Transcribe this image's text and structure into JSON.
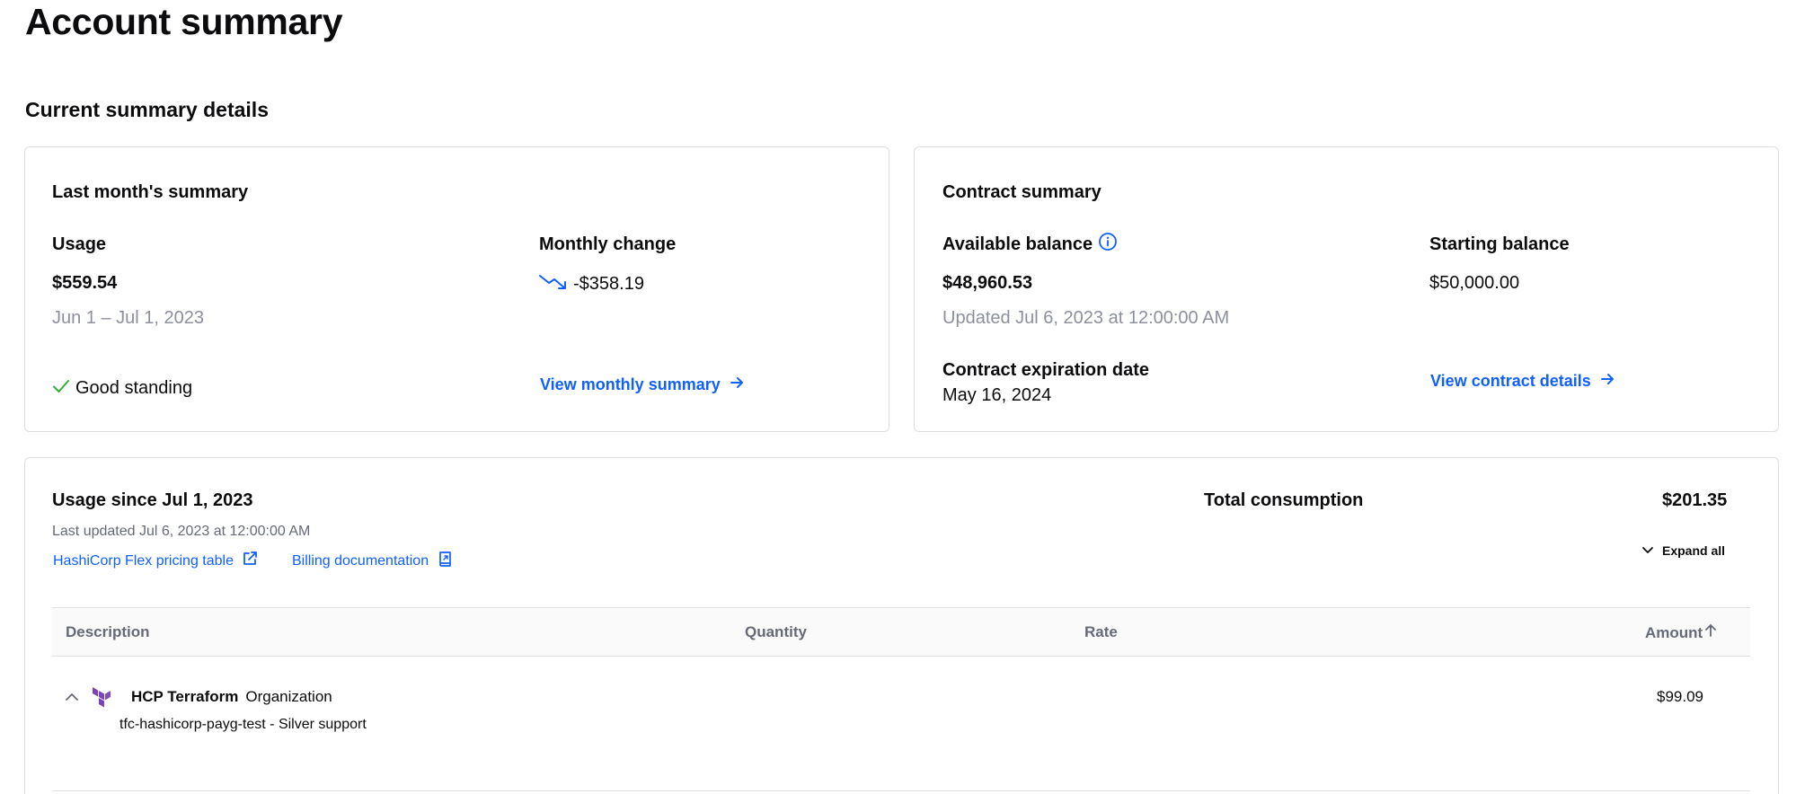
{
  "page": {
    "title": "Account summary",
    "section_title": "Current summary details"
  },
  "last_month": {
    "heading": "Last month's summary",
    "usage_label": "Usage",
    "usage_value": "$559.54",
    "usage_period": "Jun 1 – Jul 1, 2023",
    "standing": "Good standing",
    "monthly_change_label": "Monthly change",
    "monthly_change_value": "-$358.19",
    "link": "View monthly summary"
  },
  "contract": {
    "heading": "Contract summary",
    "available_label": "Available balance",
    "available_value": "$48,960.53",
    "updated": "Updated Jul 6, 2023 at 12:00:00 AM",
    "starting_label": "Starting balance",
    "starting_value": "$50,000.00",
    "expiration_label": "Contract expiration date",
    "expiration_value": "May 16, 2024",
    "link": "View contract details"
  },
  "usage": {
    "heading": "Usage since Jul 1, 2023",
    "last_updated": "Last updated Jul 6, 2023 at 12:00:00 AM",
    "pricing_link": "HashiCorp Flex pricing table",
    "billing_link": "Billing documentation",
    "total_label": "Total consumption",
    "total_value": "$201.35",
    "expand_label": "Expand all",
    "table": {
      "columns": [
        "Description",
        "Quantity",
        "Rate",
        "Amount"
      ],
      "rows": [
        {
          "product": "HCP Terraform",
          "type": "Organization",
          "detail": "tfc-hashicorp-payg-test - Silver support",
          "amount": "$99.09"
        }
      ]
    }
  },
  "colors": {
    "link": "#1060ff",
    "success": "#14c6cb",
    "success_check": "#2eb039",
    "terraform": "#7b42bc",
    "border": "#dedee3",
    "muted": "#8c909c"
  }
}
